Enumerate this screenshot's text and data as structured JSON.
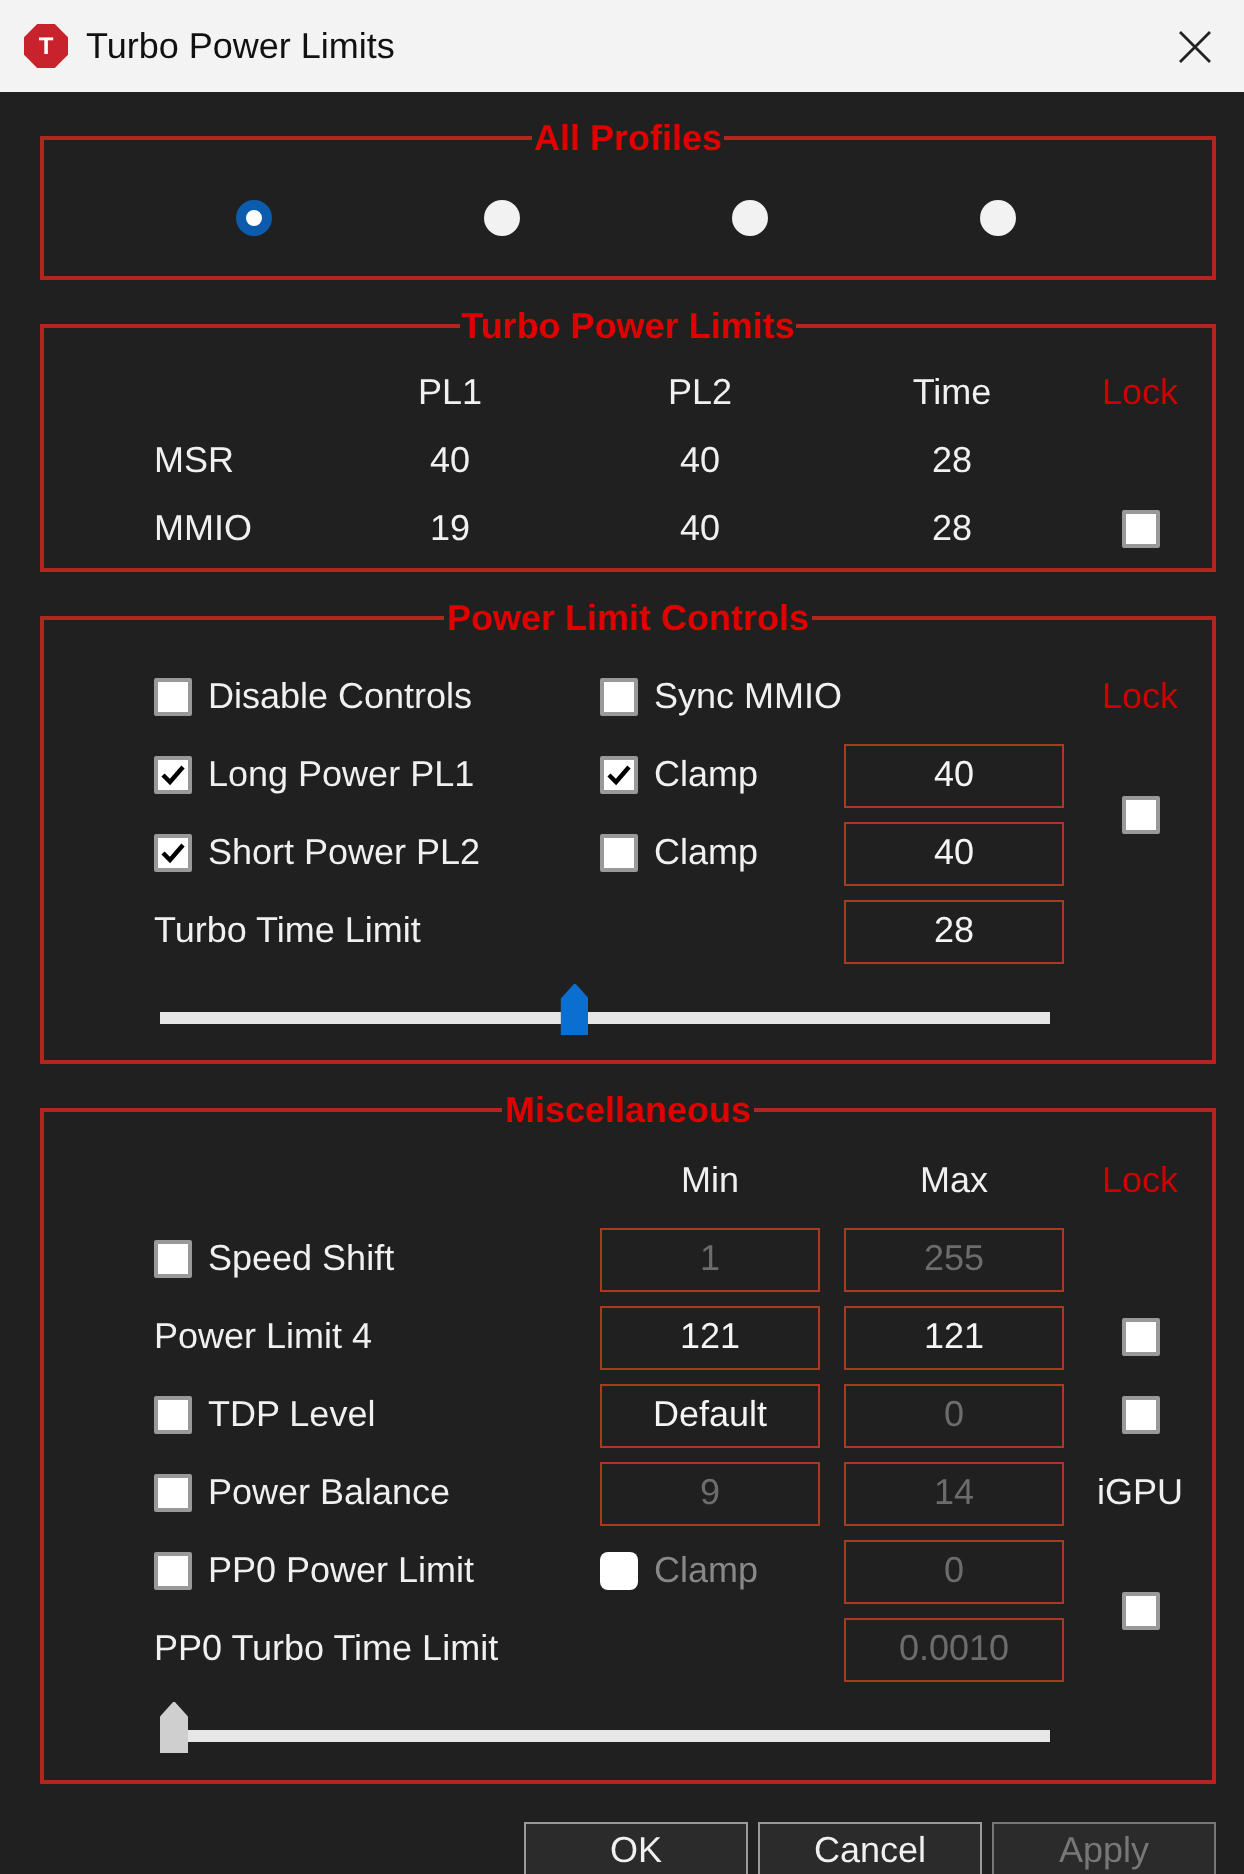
{
  "window": {
    "title": "Turbo Power Limits",
    "icon_letter": "T"
  },
  "profiles": {
    "title": "All Profiles",
    "options": [
      {
        "selected": true
      },
      {
        "selected": false
      },
      {
        "selected": false
      },
      {
        "selected": false
      }
    ]
  },
  "turbo_power_limits": {
    "title": "Turbo Power Limits",
    "columns": [
      "PL1",
      "PL2",
      "Time"
    ],
    "lock_label": "Lock",
    "rows": [
      {
        "label": "MSR",
        "values": [
          "40",
          "40",
          "28"
        ]
      },
      {
        "label": "MMIO",
        "values": [
          "19",
          "40",
          "28"
        ],
        "lock_checked": false
      }
    ]
  },
  "power_limit_controls": {
    "title": "Power Limit Controls",
    "lock_label": "Lock",
    "lock_checked": false,
    "rows": [
      {
        "kind": "check",
        "label": "Disable Controls",
        "checked": false,
        "option": {
          "label": "Sync MMIO",
          "checked": false
        }
      },
      {
        "kind": "check",
        "label": "Long Power PL1",
        "checked": true,
        "option": {
          "label": "Clamp",
          "checked": true
        },
        "value": "40"
      },
      {
        "kind": "check",
        "label": "Short Power PL2",
        "checked": true,
        "option": {
          "label": "Clamp",
          "checked": false
        },
        "value": "40"
      },
      {
        "kind": "text",
        "label": "Turbo Time Limit",
        "value": "28"
      }
    ],
    "slider": {
      "level": 0.465
    }
  },
  "miscellaneous": {
    "title": "Miscellaneous",
    "columns": [
      "Min",
      "Max"
    ],
    "lock_label": "Lock",
    "rows": [
      {
        "kind": "check",
        "label": "Speed Shift",
        "checked": false,
        "min": {
          "value": "1",
          "disabled": true
        },
        "max": {
          "value": "255",
          "disabled": true
        }
      },
      {
        "kind": "text",
        "label": "Power Limit 4",
        "min": {
          "value": "121",
          "disabled": false
        },
        "max": {
          "value": "121",
          "disabled": false
        },
        "lock_checked": false
      },
      {
        "kind": "check",
        "label": "TDP Level",
        "checked": false,
        "min": {
          "value": "Default",
          "disabled": false
        },
        "max": {
          "value": "0",
          "disabled": true
        },
        "lock_checked": false
      },
      {
        "kind": "check",
        "label": "Power Balance",
        "checked": false,
        "min": {
          "value": "9",
          "disabled": true
        },
        "max": {
          "value": "14",
          "disabled": true
        },
        "side_label": "iGPU"
      },
      {
        "kind": "check",
        "label": "PP0 Power Limit",
        "checked": false,
        "option": {
          "label": "Clamp",
          "checked": false,
          "disabled": true
        },
        "max": {
          "value": "0",
          "disabled": true
        }
      },
      {
        "kind": "text",
        "label": "PP0 Turbo Time Limit",
        "max": {
          "value": "0.0010",
          "disabled": true
        }
      }
    ],
    "pp0_lock_checked": false,
    "slider": {
      "level": 0
    }
  },
  "buttons": [
    {
      "label": "OK",
      "disabled": false
    },
    {
      "label": "Cancel",
      "disabled": false
    },
    {
      "label": "Apply",
      "disabled": true
    }
  ]
}
